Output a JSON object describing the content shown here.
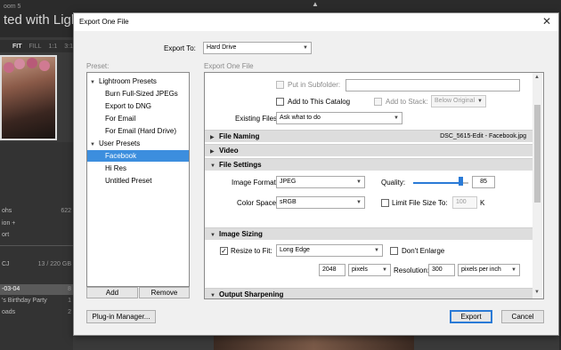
{
  "background": {
    "app_name": "oom 5",
    "title": "ted with Lightroom",
    "zoom": [
      "FIT",
      "FILL",
      "1:1",
      "3:1"
    ],
    "rows": [
      {
        "label": "ohs",
        "right": "622"
      },
      {
        "label": "ion +",
        "right": ""
      },
      {
        "label": "ort",
        "right": ""
      },
      {
        "label": "CJ",
        "right": "13 / 220 GB"
      },
      {
        "label": "-03-04",
        "right": "8"
      },
      {
        "label": "'s Birthday Party",
        "right": "1"
      },
      {
        "label": "oads",
        "right": "2"
      }
    ]
  },
  "dialog": {
    "title": "Export One File",
    "close_glyph": "✕",
    "export_to_label": "Export To:",
    "export_to_value": "Hard Drive",
    "preset_label": "Preset:",
    "section_label": "Export One File",
    "presets": [
      {
        "label": "Lightroom Presets",
        "group": true,
        "selected": false
      },
      {
        "label": "Burn Full-Sized JPEGs",
        "group": false,
        "selected": false
      },
      {
        "label": "Export to DNG",
        "group": false,
        "selected": false
      },
      {
        "label": "For Email",
        "group": false,
        "selected": false
      },
      {
        "label": "For Email (Hard Drive)",
        "group": false,
        "selected": false
      },
      {
        "label": "User Presets",
        "group": true,
        "selected": false
      },
      {
        "label": "Facebook",
        "group": false,
        "selected": true
      },
      {
        "label": "Hi Res",
        "group": false,
        "selected": false
      },
      {
        "label": "Untitled Preset",
        "group": false,
        "selected": false
      }
    ],
    "add_button": "Add",
    "remove_button": "Remove",
    "plugin_button": "Plug-in Manager...",
    "export_button": "Export",
    "cancel_button": "Cancel",
    "location": {
      "put_in_subfolder": "Put in Subfolder:",
      "subfolder_value": "",
      "add_to_catalog": "Add to This Catalog",
      "add_to_stack": "Add to Stack:",
      "stack_position": "Below Original",
      "existing_files_label": "Existing Files:",
      "existing_files_value": "Ask what to do"
    },
    "file_naming": {
      "title": "File Naming",
      "filename": "DSC_5615-Edit - Facebook.jpg"
    },
    "video": {
      "title": "Video"
    },
    "file_settings": {
      "title": "File Settings",
      "image_format_label": "Image Format:",
      "image_format_value": "JPEG",
      "quality_label": "Quality:",
      "quality_value": "85",
      "quality_fraction": 0.85,
      "color_space_label": "Color Space:",
      "color_space_value": "sRGB",
      "limit_file_size_label": "Limit File Size To:",
      "limit_value": "100",
      "limit_unit": "K"
    },
    "image_sizing": {
      "title": "Image Sizing",
      "resize_to_fit_label": "Resize to Fit:",
      "resize_mode": "Long Edge",
      "dont_enlarge": "Don't Enlarge",
      "size_value": "2048",
      "size_unit": "pixels",
      "resolution_label": "Resolution:",
      "resolution_value": "300",
      "resolution_unit": "pixels per inch"
    },
    "output_sharpening": {
      "title": "Output Sharpening"
    }
  }
}
